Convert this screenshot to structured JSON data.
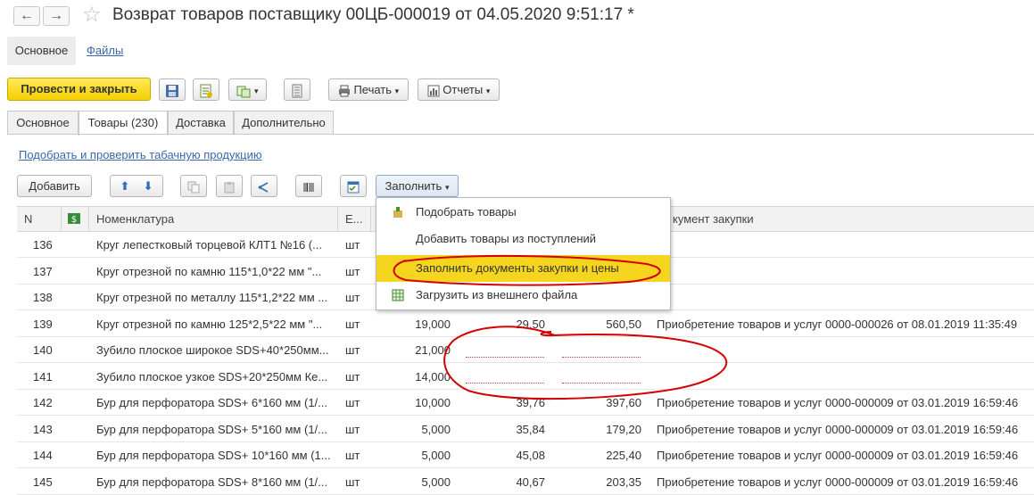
{
  "window": {
    "title": "Возврат товаров поставщику 00ЦБ-000019 от 04.05.2020 9:51:17 *"
  },
  "nav": {
    "back": "←",
    "forward": "→"
  },
  "top_tabs": {
    "main": "Основное",
    "files": "Файлы"
  },
  "toolbar": {
    "post_and_close": "Провести и закрыть",
    "print": "Печать",
    "reports": "Отчеты"
  },
  "section_tabs": [
    "Основное",
    "Товары (230)",
    "Доставка",
    "Дополнительно"
  ],
  "tobacco_link": "Подобрать и проверить табачную продукцию",
  "table_toolbar": {
    "add": "Добавить",
    "fill": "Заполнить"
  },
  "table": {
    "headers": {
      "n": "N",
      "item": "Номенклатура",
      "unit": "Е...",
      "doc": "кумент закупки"
    },
    "rows": [
      {
        "n": "136",
        "item": "Круг лепестковый торцевой КЛТ1 №16 (...",
        "unit": "шт",
        "qty": "",
        "price": "",
        "sum": "",
        "doc": ""
      },
      {
        "n": "137",
        "item": "Круг отрезной по камню 115*1,0*22 мм \"...",
        "unit": "шт",
        "qty": "",
        "price": "",
        "sum": "",
        "doc": ""
      },
      {
        "n": "138",
        "item": "Круг отрезной по металлу 115*1,2*22 мм ...",
        "unit": "шт",
        "qty": "",
        "price": "",
        "sum": "",
        "doc": ""
      },
      {
        "n": "139",
        "item": "Круг отрезной по камню 125*2,5*22 мм \"...",
        "unit": "шт",
        "qty": "19,000",
        "price": "29,50",
        "sum": "560,50",
        "doc": "Приобретение товаров и услуг 0000-000026 от 08.01.2019 11:35:49"
      },
      {
        "n": "140",
        "item": "Зубило плоское широкое SDS+40*250мм...",
        "unit": "шт",
        "qty": "21,000",
        "price": "",
        "sum": "",
        "doc": ""
      },
      {
        "n": "141",
        "item": "Зубило плоское узкое SDS+20*250мм Ке...",
        "unit": "шт",
        "qty": "14,000",
        "price": "",
        "sum": "",
        "doc": ""
      },
      {
        "n": "142",
        "item": "Бур для перфоратора SDS+ 6*160 мм (1/...",
        "unit": "шт",
        "qty": "10,000",
        "price": "39,76",
        "sum": "397,60",
        "doc": "Приобретение товаров и услуг 0000-000009 от 03.01.2019 16:59:46"
      },
      {
        "n": "143",
        "item": "Бур для перфоратора SDS+ 5*160 мм (1/...",
        "unit": "шт",
        "qty": "5,000",
        "price": "35,84",
        "sum": "179,20",
        "doc": "Приобретение товаров и услуг 0000-000009 от 03.01.2019 16:59:46"
      },
      {
        "n": "144",
        "item": "Бур для перфоратора SDS+ 10*160 мм (1...",
        "unit": "шт",
        "qty": "5,000",
        "price": "45,08",
        "sum": "225,40",
        "doc": "Приобретение товаров и услуг 0000-000009 от 03.01.2019 16:59:46"
      },
      {
        "n": "145",
        "item": "Бур для перфоратора SDS+ 8*160 мм (1/...",
        "unit": "шт",
        "qty": "5,000",
        "price": "40,67",
        "sum": "203,35",
        "doc": "Приобретение товаров и услуг 0000-000009 от 03.01.2019 16:59:46"
      }
    ]
  },
  "fill_menu": {
    "items": [
      "Подобрать товары",
      "Добавить товары из поступлений",
      "Заполнить документы закупки и цены",
      "Загрузить из внешнего файла"
    ],
    "selected_index": 2
  },
  "colors": {
    "primary_button": "#f4cf00",
    "highlight": "#f5d51e",
    "link": "#3b68a8",
    "annotation": "#d40000"
  }
}
